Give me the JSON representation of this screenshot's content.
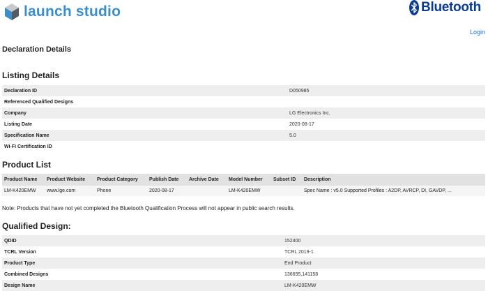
{
  "header": {
    "brand_name": "launch studio",
    "bluetooth_brand": "Bluetooth",
    "login_label": "Login",
    "colors": {
      "brand_blue": "#3b8ec9",
      "bluetooth_blue": "#0a3d91",
      "link": "#1a6fc9"
    }
  },
  "page": {
    "title": "Declaration Details"
  },
  "listing": {
    "heading": "Listing Details",
    "rows": [
      {
        "label": "Declaration ID",
        "value": "D050985"
      },
      {
        "label": "Referenced Qualified Designs",
        "value": ""
      },
      {
        "label": "Company",
        "value": "LG Electronics Inc."
      },
      {
        "label": "Listing Date",
        "value": "2020-08-17"
      },
      {
        "label": "Specification Name",
        "value": "5.0"
      },
      {
        "label": "Wi-Fi Certification ID",
        "value": ""
      }
    ]
  },
  "product_list": {
    "heading": "Product List",
    "columns": [
      "Product Name",
      "Product Website",
      "Product Category",
      "Publish Date",
      "Archive Date",
      "Model Number",
      "Subset ID",
      "Description"
    ],
    "rows": [
      [
        "LM-K420EMW",
        "www.lge.com",
        "Phone",
        "2020-08-17",
        "",
        "LM-K420EMW",
        "",
        "Spec Name : v5.0 Supported Profiles : A2DP, AVRCP, DI, GAVDP, ..."
      ]
    ],
    "note": "Note: Products that have not yet completed the Bluetooth Qualification Process will not appear in public search results."
  },
  "qualified_design": {
    "heading": "Qualified Design:",
    "rows": [
      {
        "label": "QDID",
        "value": "152400"
      },
      {
        "label": "TCRL Version",
        "value": "TCRL 2019-1"
      },
      {
        "label": "Product Type",
        "value": "End Product"
      },
      {
        "label": "Combined Designs",
        "value": "136695,141158"
      },
      {
        "label": "Design Name",
        "value": "LM-K420EMW"
      }
    ]
  }
}
